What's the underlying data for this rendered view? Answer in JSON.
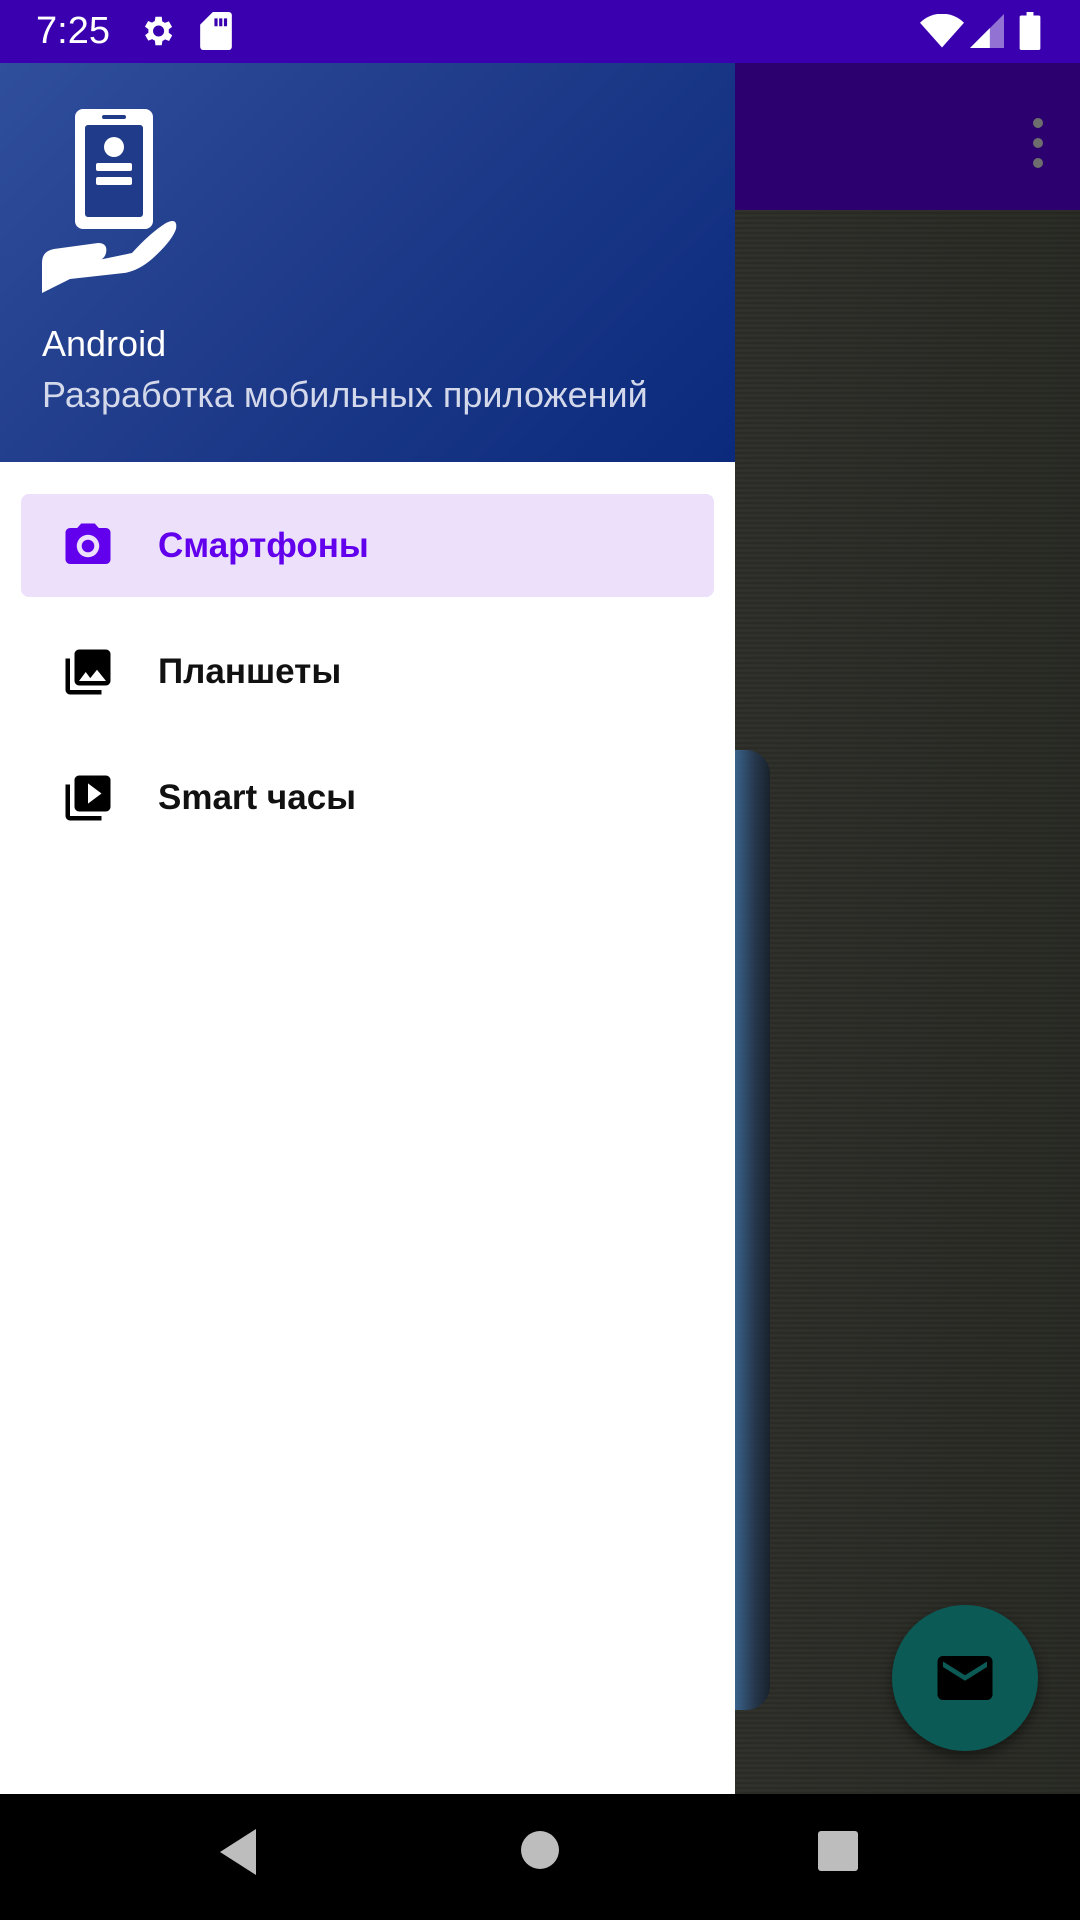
{
  "status_bar": {
    "time": "7:25",
    "icons": [
      "settings-icon",
      "sd-card-icon",
      "wifi-icon",
      "signal-icon",
      "battery-icon"
    ]
  },
  "drawer": {
    "header": {
      "logo_icon": "hand-holding-phone-icon",
      "title": "Android",
      "subtitle": "Разработка мобильных приложений"
    },
    "items": [
      {
        "label": "Смартфоны",
        "icon": "camera-icon",
        "selected": true
      },
      {
        "label": "Планшеты",
        "icon": "photo-library-icon",
        "selected": false
      },
      {
        "label": "Smart часы",
        "icon": "video-library-icon",
        "selected": false
      }
    ]
  },
  "app": {
    "toolbar_menu_icon": "more-vert-icon",
    "fab_icon": "mail-icon"
  },
  "colors": {
    "status_bar": "#3a00b0",
    "accent": "#6200ee",
    "selected_item_bg": "#ece0fa",
    "drawer_header": "#1f3b8a",
    "fab": "#0b5a55"
  },
  "nav_bar": {
    "buttons": [
      "back-icon",
      "home-icon",
      "recents-icon"
    ]
  }
}
